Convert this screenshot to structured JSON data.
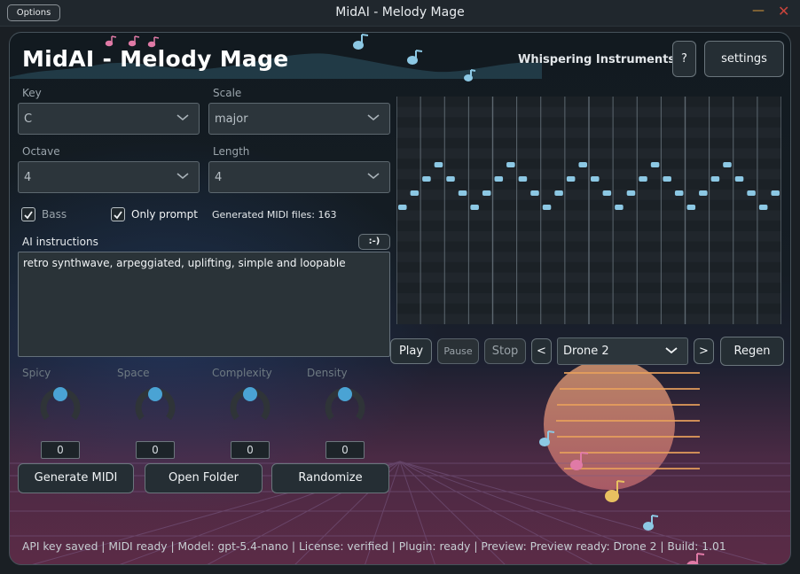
{
  "window": {
    "title": "MidAI - Melody Mage",
    "options_label": "Options",
    "minimize_glyph": "—",
    "close_glyph": "✕"
  },
  "header": {
    "app_title": "MidAI - Melody Mage",
    "whisper_link": "Whispering Instruments",
    "help_label": "?",
    "settings_label": "settings"
  },
  "controls": {
    "key": {
      "label": "Key",
      "value": "C"
    },
    "scale": {
      "label": "Scale",
      "value": "major"
    },
    "octave": {
      "label": "Octave",
      "value": "4"
    },
    "length": {
      "label": "Length",
      "value": "4"
    },
    "bass": {
      "label": "Bass",
      "checked": true
    },
    "only_prompt": {
      "label": "Only prompt",
      "checked": true
    },
    "generated_count": "Generated MIDI files: 163"
  },
  "ai": {
    "label": "AI instructions",
    "smiley_label": ":-)",
    "text": "retro synthwave, arpeggiated, uplifting, simple and loopable"
  },
  "knobs": [
    {
      "label": "Spicy",
      "value": "0"
    },
    {
      "label": "Space",
      "value": "0"
    },
    {
      "label": "Complexity",
      "value": "0"
    },
    {
      "label": "Density",
      "value": "0"
    }
  ],
  "actions": {
    "generate": "Generate MIDI",
    "open_folder": "Open Folder",
    "randomize": "Randomize"
  },
  "player": {
    "play": "Play",
    "pause": "Pause",
    "stop": "Stop",
    "prev": "<",
    "next": ">",
    "preset": "Drone 2",
    "regen": "Regen"
  },
  "piano_roll": {
    "notes": [
      2,
      3,
      4,
      5,
      4,
      3,
      2,
      3,
      4,
      5,
      4,
      3,
      2,
      3,
      4,
      5,
      4,
      3,
      2,
      3,
      4,
      5,
      4,
      3,
      2,
      3,
      4,
      5,
      4,
      3,
      2,
      3
    ]
  },
  "status_bar": "API key saved | MIDI ready | Model: gpt-5.4-nano | License: verified | Plugin: ready | Preview: Preview ready: Drone 2 | Build: 1.01",
  "colors": {
    "accent": "#4aa3d4",
    "note_blue": "#8cc8e4",
    "note_pink": "#e07aa6",
    "note_yellow": "#e8c060",
    "sun": "#e69a72"
  }
}
